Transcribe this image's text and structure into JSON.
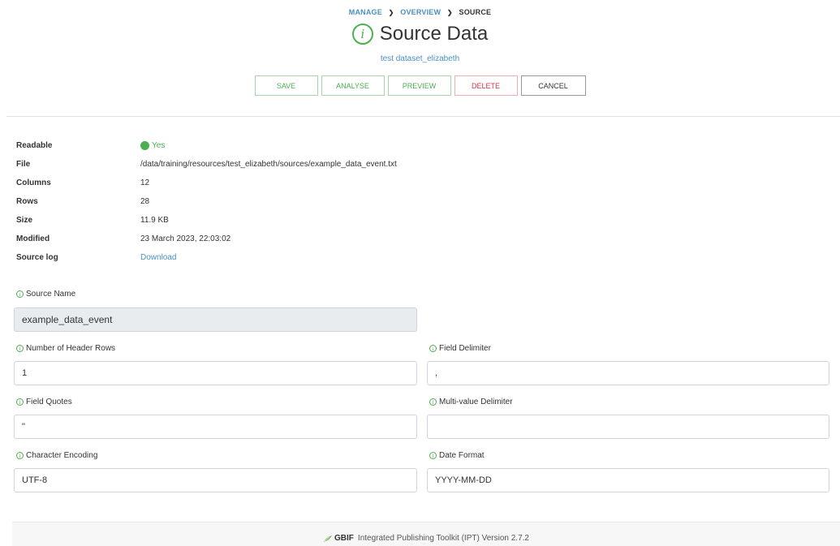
{
  "breadcrumb": {
    "manage": "MANAGE",
    "sep1": ">",
    "overview": "OVERVIEW",
    "sep2": ">",
    "current": "SOURCE"
  },
  "header": {
    "title_icon": "i",
    "title": "Source Data",
    "subtitle": "test dataset_elizabeth"
  },
  "toolbar": {
    "save_label": "SAVE",
    "analyse_label": "ANALYSE",
    "preview_label": "PREVIEW",
    "delete_label": "DELETE",
    "cancel_label": "CANCEL"
  },
  "info": {
    "readable_label": "Readable",
    "readable_value": "Yes",
    "file_label": "File",
    "file_value": "/data/training/resources/test_elizabeth/sources/example_data_event.txt",
    "columns_label": "Columns",
    "columns_value": "12",
    "rows_label": "Rows",
    "rows_value": "28",
    "size_label": "Size",
    "size_value": "11.9 KB",
    "modified_label": "Modified",
    "modified_value": "23 March 2023, 22:03:02",
    "log_label": "Source log",
    "log_value": "Download"
  },
  "form": {
    "info_glyph": "i",
    "source_name_label": "Source Name",
    "source_name_value": "example_data_event",
    "header_rows_label": "Number of Header Rows",
    "header_rows_value": "1",
    "field_delimiter_label": "Field Delimiter",
    "field_delimiter_value": ",",
    "field_quotes_label": "Field Quotes",
    "field_quotes_value": "\"",
    "multi_delimiter_label": "Multi-value Delimiter",
    "multi_delimiter_value": "",
    "encoding_label": "Character Encoding",
    "encoding_value": "UTF-8",
    "date_format_label": "Date Format",
    "date_format_value": "YYYY-MM-DD"
  },
  "footer": {
    "logo_icon": "gbif-leaf-icon",
    "logo_text": "GBIF",
    "text": "Integrated Publishing Toolkit (IPT) Version 2.7.2"
  },
  "colors": {
    "accent_green": "#4caf50",
    "link_blue": "#4a90c2",
    "danger_red": "#dc3545"
  }
}
